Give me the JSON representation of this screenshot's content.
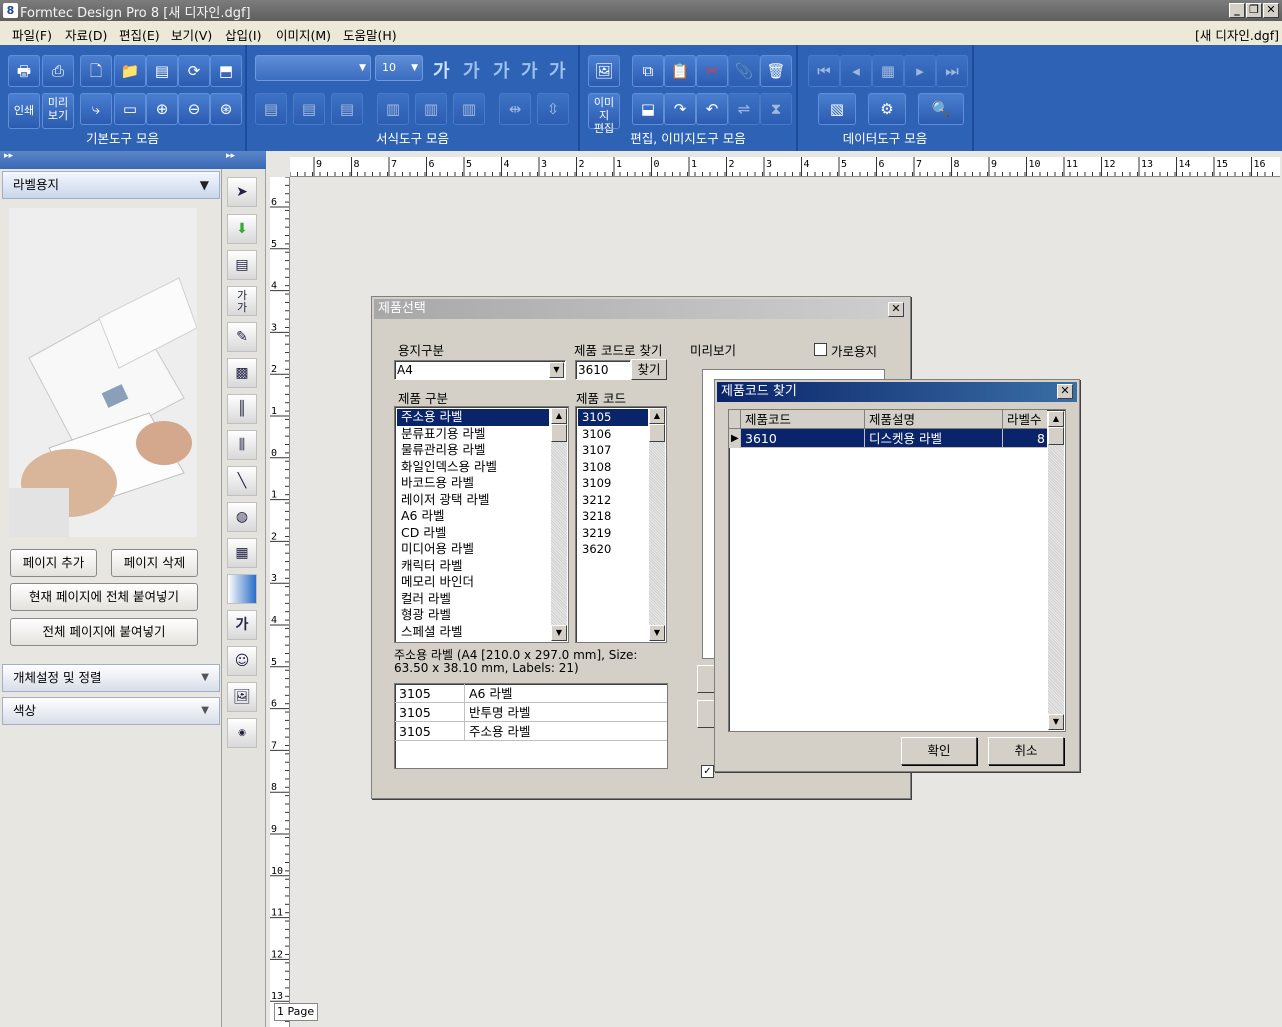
{
  "window": {
    "app_icon": "8",
    "title": "Formtec Design Pro 8 [새 디자인.dgf]"
  },
  "menu": {
    "items": [
      "파일(F)",
      "자료(D)",
      "편집(E)",
      "보기(V)",
      "삽입(I)",
      "이미지(M)",
      "도움말(H)"
    ],
    "document": "[새 디자인.dgf]"
  },
  "toolbar": {
    "groups": [
      "기본도구 모음",
      "서식도구 모음",
      "편집, 이미지도구 모음",
      "데이터도구 모음"
    ],
    "print_label": "인쇄",
    "preview_label": "미리\n보기",
    "image_edit_label": "이미지\n편집",
    "font_size": "10",
    "format_glyphs": [
      "가",
      "가",
      "가",
      "가",
      "가"
    ]
  },
  "left_panel": {
    "section_label_paper": "라벨용지",
    "buttons": {
      "add_page": "페이지 추가",
      "delete_page": "페이지 삭제",
      "paste_current": "현재 페이지에 전체 붙여넣기",
      "paste_all": "전체 페이지에 붙여넣기"
    },
    "section_object": "개체설정 및 정렬",
    "section_color": "색상"
  },
  "canvas": {
    "h_ruler": [
      "9",
      "8",
      "7",
      "6",
      "5",
      "4",
      "3",
      "2",
      "1",
      "0",
      "1",
      "2",
      "3",
      "4",
      "5",
      "6",
      "7",
      "8",
      "9",
      "10",
      "11",
      "12",
      "13",
      "14",
      "15",
      "16"
    ],
    "v_ruler": [
      "6",
      "5",
      "4",
      "3",
      "2",
      "1",
      "0",
      "1",
      "2",
      "3",
      "4",
      "5",
      "6",
      "7",
      "8",
      "9",
      "10",
      "11",
      "12",
      "13"
    ],
    "page_tab": "1 Page"
  },
  "product_dialog": {
    "title": "제품선택",
    "paper_type_label": "용지구분",
    "paper_type_value": "A4",
    "search_label": "제품 코드로 찾기",
    "search_value": "3610",
    "search_button": "찾기",
    "preview_label": "미리보기",
    "landscape_label": "가로용지",
    "category_label": "제품 구분",
    "categories": [
      "주소용 라벨",
      "분류표기용 라벨",
      "물류관리용 라벨",
      "화일인덱스용 라벨",
      "바코드용 라벨",
      "레이저 광택 라벨",
      "A6 라벨",
      "CD 라벨",
      "미디어용 라벨",
      "캐릭터 라벨",
      "메모리 바인더",
      "컬러 라벨",
      "형광 라벨",
      "스페셜 라벨"
    ],
    "code_label": "제품 코드",
    "codes": [
      "3105",
      "3106",
      "3107",
      "3108",
      "3109",
      "3212",
      "3218",
      "3219",
      "3620"
    ],
    "description": "주소용 라벨 (A4 [210.0 x 297.0 mm], Size: 63.50 x 38.10 mm, Labels: 21)",
    "recent": [
      [
        "3105",
        "A6 라벨"
      ],
      [
        "3105",
        "반투명 라벨"
      ],
      [
        "3105",
        "주소용 라벨"
      ]
    ]
  },
  "search_dialog": {
    "title": "제품코드 찾기",
    "columns": [
      "제품코드",
      "제품설명",
      "라벨수"
    ],
    "rows": [
      [
        "3610",
        "디스켓용 라벨",
        "8"
      ]
    ],
    "ok": "확인",
    "cancel": "취소"
  }
}
